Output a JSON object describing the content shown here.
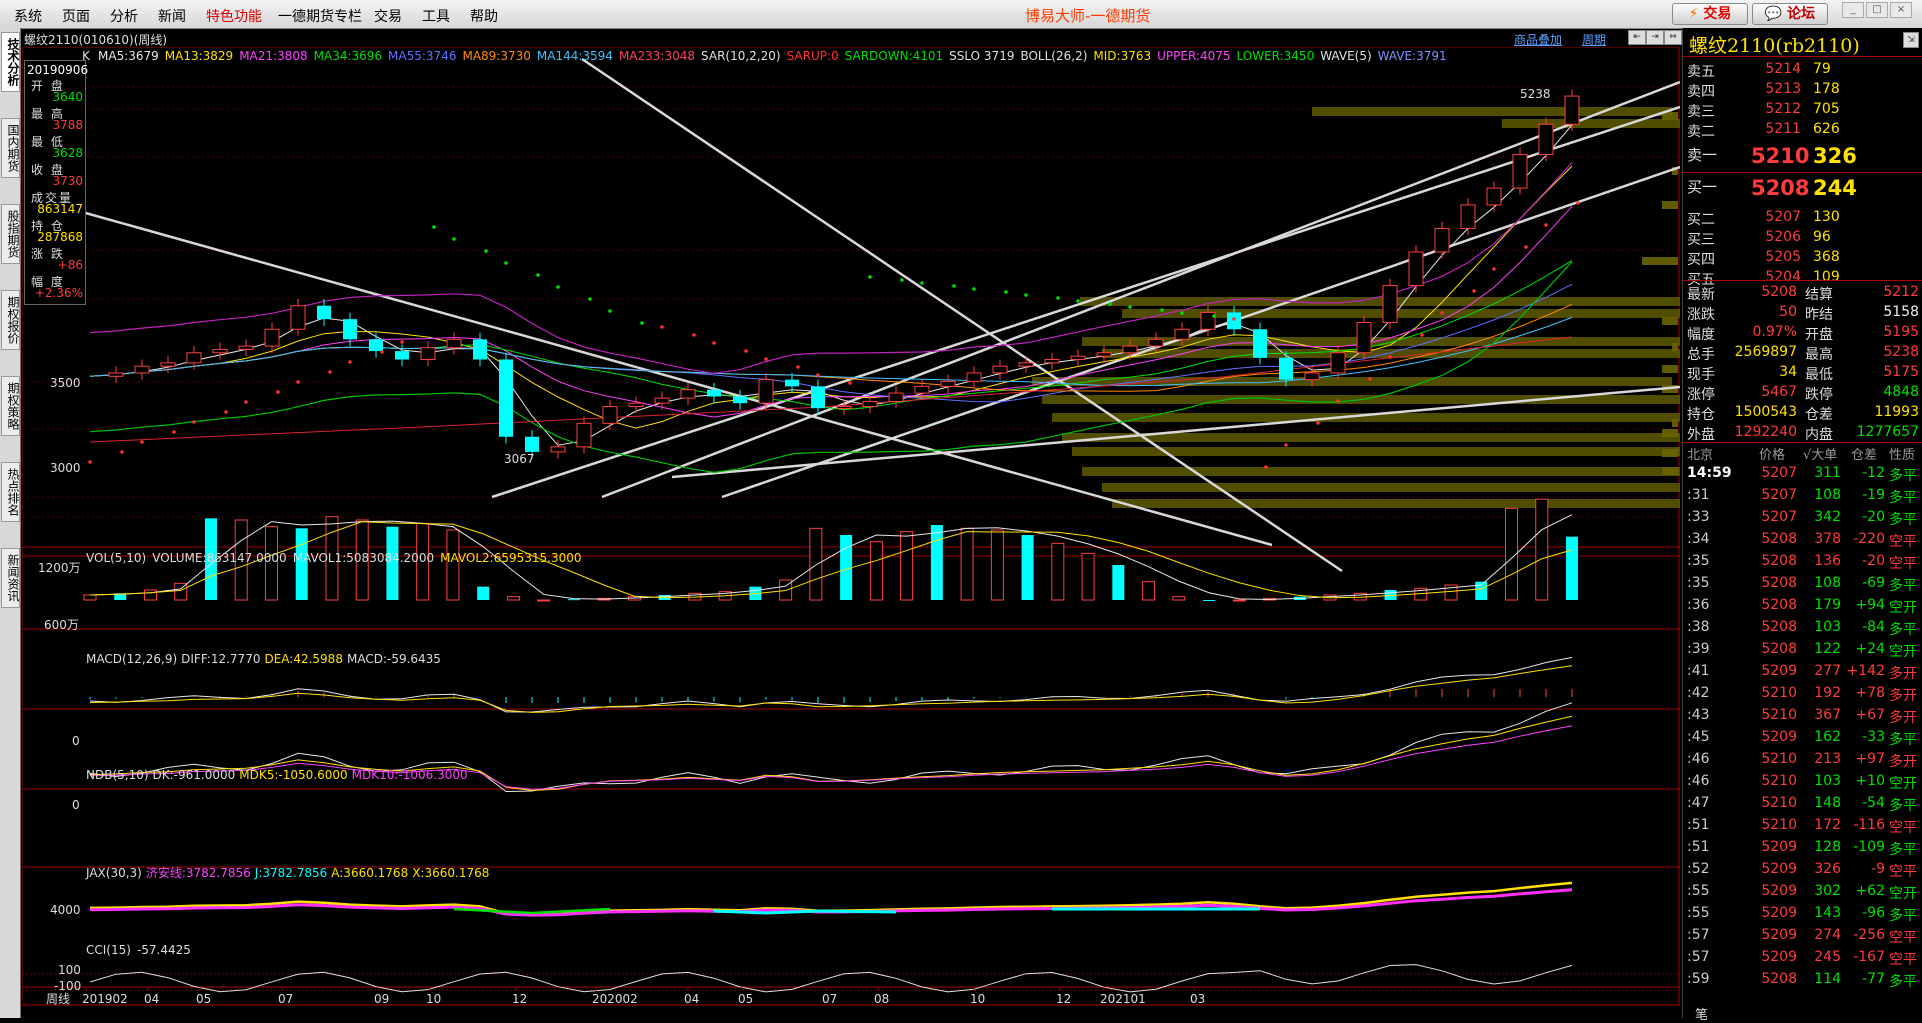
{
  "menu": {
    "items": [
      "系统",
      "页面",
      "分析",
      "新闻",
      "特色功能",
      "一德期货专栏",
      "交易",
      "工具",
      "帮助"
    ],
    "special_index": 4,
    "app_title": "博易大师-一德期货",
    "trade_button": "交易",
    "forum_button": "论坛"
  },
  "left_tabs": [
    "技术分析",
    "国内期货",
    "股指期货",
    "期权报价",
    "期权策略",
    "热点排名",
    "新闻资讯"
  ],
  "header": {
    "symbol": "螺纹2110(010610)(周线)",
    "k_label": "K",
    "link_overlay": "商品叠加",
    "link_period": "周期",
    "ma_items": [
      {
        "text": "MA5:3679",
        "color": "#e8e8e8"
      },
      {
        "text": "MA13:3829",
        "color": "#ffe000"
      },
      {
        "text": "MA21:3808",
        "color": "#ff40ff"
      },
      {
        "text": "MA34:3696",
        "color": "#00e000"
      },
      {
        "text": "MA55:3746",
        "color": "#6070ff"
      },
      {
        "text": "MA89:3730",
        "color": "#ff8c00"
      },
      {
        "text": "MA144:3594",
        "color": "#40c0ff"
      },
      {
        "text": "MA233:3048",
        "color": "#ff4060"
      },
      {
        "text": "SAR(10,2,20)",
        "color": "#e0e0e0"
      },
      {
        "text": "SARUP:0",
        "color": "#ff3030"
      },
      {
        "text": "SARDOWN:4101",
        "color": "#00e000"
      },
      {
        "text": "SSLO 3719",
        "color": "#e0e0e0"
      },
      {
        "text": "BOLL(26,2)",
        "color": "#e0e0e0"
      },
      {
        "text": "MID:3763",
        "color": "#ffe000"
      },
      {
        "text": "UPPER:4075",
        "color": "#ff40ff"
      },
      {
        "text": "LOWER:3450",
        "color": "#00e000"
      },
      {
        "text": "WAVE(5)",
        "color": "#e0e0e0"
      },
      {
        "text": "WAVE:3791",
        "color": "#8090ff"
      }
    ]
  },
  "infobox": {
    "date": "20190906",
    "rows": [
      {
        "label": "开  盘",
        "value": "3640",
        "color": "#00e000"
      },
      {
        "label": "最  高",
        "value": "3788",
        "color": "#ff3b3b"
      },
      {
        "label": "最  低",
        "value": "3628",
        "color": "#00e000"
      },
      {
        "label": "收  盘",
        "value": "3730",
        "color": "#ff3b3b"
      },
      {
        "label": "成交量",
        "value": "863147",
        "color": "#ffe000"
      },
      {
        "label": "持  仓",
        "value": "287868",
        "color": "#ffe000"
      },
      {
        "label": "涨  跌",
        "value": "+86",
        "color": "#ff3b3b"
      },
      {
        "label": "幅  度",
        "value": "+2.36%",
        "color": "#ff3b3b"
      }
    ]
  },
  "panels": {
    "price_axis": [
      "3500",
      "3000"
    ],
    "price_partial": "4000",
    "high_label": "5238",
    "low_label": "3067",
    "vol_header": [
      {
        "text": "VOL(5,10)",
        "color": "#ddd"
      },
      {
        "text": "VOLUME:863147.0000",
        "color": "#ddd"
      },
      {
        "text": "MAVOL1:5083084.2000",
        "color": "#ddd"
      },
      {
        "text": "MAVOL2:6595315.3000",
        "color": "#ffe000"
      }
    ],
    "vol_axis": [
      "1200万",
      "600万"
    ],
    "macd_header": [
      {
        "text": "MACD(12,26,9)",
        "color": "#ddd"
      },
      {
        "text": "DIFF:12.7770",
        "color": "#ddd"
      },
      {
        "text": "DEA:42.5988",
        "color": "#ffe000"
      },
      {
        "text": "MACD:-59.6435",
        "color": "#ddd"
      }
    ],
    "macd_axis": "0",
    "ndb_header": [
      {
        "text": "NDB(5,10)",
        "color": "#ddd"
      },
      {
        "text": "DK:-961.0000",
        "color": "#ddd"
      },
      {
        "text": "MDK5:-1050.6000",
        "color": "#ffe000"
      },
      {
        "text": "MDK10:-1006.3000",
        "color": "#ff40ff"
      }
    ],
    "ndb_axis": "0",
    "jax_header": [
      {
        "text": "JAX(30,3)",
        "color": "#ddd"
      },
      {
        "text": "济安线:3782.7856",
        "color": "#ff40ff"
      },
      {
        "text": "J:3782.7856",
        "color": "#00ffff"
      },
      {
        "text": "A:3660.1768",
        "color": "#ffe000"
      },
      {
        "text": "X:3660.1768",
        "color": "#ffe000"
      }
    ],
    "jax_axis": "4000",
    "cci_header": [
      {
        "text": "CCI(15)",
        "color": "#ddd"
      },
      {
        "text": "-57.4425",
        "color": "#ddd"
      }
    ],
    "cci_axis": [
      "100",
      "-100"
    ]
  },
  "time_axis": {
    "label": "周线",
    "ticks": [
      "201902",
      "04",
      "05",
      "07",
      "09",
      "10",
      "12",
      "202002",
      "04",
      "05",
      "07",
      "08",
      "10",
      "12",
      "202101",
      "03"
    ]
  },
  "right_panel": {
    "title": "螺纹2110(rb2110)",
    "asks": [
      {
        "label": "卖五",
        "price": "5214",
        "vol": "79"
      },
      {
        "label": "卖四",
        "price": "5213",
        "vol": "178"
      },
      {
        "label": "卖三",
        "price": "5212",
        "vol": "705"
      },
      {
        "label": "卖二",
        "price": "5211",
        "vol": "626"
      },
      {
        "label": "卖一",
        "price": "5210",
        "vol": "326"
      }
    ],
    "bids": [
      {
        "label": "买一",
        "price": "5208",
        "vol": "244"
      },
      {
        "label": "买二",
        "price": "5207",
        "vol": "130"
      },
      {
        "label": "买三",
        "price": "5206",
        "vol": "96"
      },
      {
        "label": "买四",
        "price": "5205",
        "vol": "368"
      },
      {
        "label": "买五",
        "price": "5204",
        "vol": "109"
      }
    ],
    "quote": [
      {
        "l1": "最新",
        "v1": "5208",
        "c1": "red",
        "l2": "结算",
        "v2": "5212",
        "c2": "red"
      },
      {
        "l1": "涨跌",
        "v1": "50",
        "c1": "red",
        "l2": "昨结",
        "v2": "5158",
        "c2": "white"
      },
      {
        "l1": "幅度",
        "v1": "0.97%",
        "c1": "red",
        "l2": "开盘",
        "v2": "5195",
        "c2": "red"
      },
      {
        "l1": "总手",
        "v1": "2569897",
        "c1": "yellow",
        "l2": "最高",
        "v2": "5238",
        "c2": "red"
      },
      {
        "l1": "现手",
        "v1": "34",
        "c1": "yellow",
        "l2": "最低",
        "v2": "5175",
        "c2": "red"
      },
      {
        "l1": "涨停",
        "v1": "5467",
        "c1": "red",
        "l2": "跌停",
        "v2": "4848",
        "c2": "green"
      },
      {
        "l1": "持仓",
        "v1": "1500543",
        "c1": "yellow",
        "l2": "仓差",
        "v2": "11993",
        "c2": "yellow"
      },
      {
        "l1": "外盘",
        "v1": "1292240",
        "c1": "red",
        "l2": "内盘",
        "v2": "1277657",
        "c2": "green"
      }
    ],
    "tick_header": [
      "北京",
      "价格",
      "√大单",
      "仓差",
      "性质"
    ],
    "ticks": [
      {
        "time": "14:59",
        "price": "5207",
        "vol": "311",
        "chg": "-12",
        "nature": "多平",
        "vc": "green",
        "cc": "green",
        "nc": "green"
      },
      {
        "time": ":31",
        "price": "5207",
        "vol": "108",
        "chg": "-19",
        "nature": "多平",
        "vc": "green",
        "cc": "green",
        "nc": "green"
      },
      {
        "time": ":33",
        "price": "5207",
        "vol": "342",
        "chg": "-20",
        "nature": "多平",
        "vc": "green",
        "cc": "green",
        "nc": "green"
      },
      {
        "time": ":34",
        "price": "5208",
        "vol": "378",
        "chg": "-220",
        "nature": "空平",
        "vc": "red",
        "cc": "red",
        "nc": "red"
      },
      {
        "time": ":35",
        "price": "5208",
        "vol": "136",
        "chg": "-20",
        "nature": "空平",
        "vc": "red",
        "cc": "red",
        "nc": "red"
      },
      {
        "time": ":35",
        "price": "5208",
        "vol": "108",
        "chg": "-69",
        "nature": "多平",
        "vc": "green",
        "cc": "green",
        "nc": "green"
      },
      {
        "time": ":36",
        "price": "5208",
        "vol": "179",
        "chg": "+94",
        "nature": "空开",
        "vc": "green",
        "cc": "green",
        "nc": "green"
      },
      {
        "time": ":38",
        "price": "5208",
        "vol": "103",
        "chg": "-84",
        "nature": "多平",
        "vc": "green",
        "cc": "green",
        "nc": "green"
      },
      {
        "time": ":39",
        "price": "5208",
        "vol": "122",
        "chg": "+24",
        "nature": "空开",
        "vc": "green",
        "cc": "green",
        "nc": "green"
      },
      {
        "time": ":41",
        "price": "5209",
        "vol": "277",
        "chg": "+142",
        "nature": "多开",
        "vc": "red",
        "cc": "red",
        "nc": "red"
      },
      {
        "time": ":42",
        "price": "5210",
        "vol": "192",
        "chg": "+78",
        "nature": "多开",
        "vc": "red",
        "cc": "red",
        "nc": "red"
      },
      {
        "time": ":43",
        "price": "5210",
        "vol": "367",
        "chg": "+67",
        "nature": "多开",
        "vc": "red",
        "cc": "red",
        "nc": "red"
      },
      {
        "time": ":45",
        "price": "5209",
        "vol": "162",
        "chg": "-33",
        "nature": "多平",
        "vc": "green",
        "cc": "green",
        "nc": "green"
      },
      {
        "time": ":46",
        "price": "5210",
        "vol": "213",
        "chg": "+97",
        "nature": "多开",
        "vc": "red",
        "cc": "red",
        "nc": "red"
      },
      {
        "time": ":46",
        "price": "5210",
        "vol": "103",
        "chg": "+10",
        "nature": "空开",
        "vc": "green",
        "cc": "green",
        "nc": "green"
      },
      {
        "time": ":47",
        "price": "5210",
        "vol": "148",
        "chg": "-54",
        "nature": "多平",
        "vc": "green",
        "cc": "green",
        "nc": "green"
      },
      {
        "time": ":51",
        "price": "5210",
        "vol": "172",
        "chg": "-116",
        "nature": "空平",
        "vc": "red",
        "cc": "red",
        "nc": "red"
      },
      {
        "time": ":51",
        "price": "5209",
        "vol": "128",
        "chg": "-109",
        "nature": "多平",
        "vc": "green",
        "cc": "green",
        "nc": "green"
      },
      {
        "time": ":52",
        "price": "5209",
        "vol": "326",
        "chg": "-9",
        "nature": "空平",
        "vc": "red",
        "cc": "red",
        "nc": "red"
      },
      {
        "time": ":55",
        "price": "5209",
        "vol": "302",
        "chg": "+62",
        "nature": "空开",
        "vc": "green",
        "cc": "green",
        "nc": "green"
      },
      {
        "time": ":55",
        "price": "5209",
        "vol": "143",
        "chg": "-96",
        "nature": "多平",
        "vc": "green",
        "cc": "green",
        "nc": "green"
      },
      {
        "time": ":57",
        "price": "5209",
        "vol": "274",
        "chg": "-256",
        "nature": "空平",
        "vc": "red",
        "cc": "red",
        "nc": "red"
      },
      {
        "time": ":57",
        "price": "5209",
        "vol": "245",
        "chg": "-167",
        "nature": "空平",
        "vc": "red",
        "cc": "red",
        "nc": "red"
      },
      {
        "time": ":59",
        "price": "5208",
        "vol": "114",
        "chg": "-77",
        "nature": "多平",
        "vc": "green",
        "cc": "green",
        "nc": "green"
      }
    ],
    "bottom_label": "笔"
  },
  "chart_data": {
    "type": "candlestick",
    "period": "weekly",
    "symbol": "螺纹2110",
    "price_series_approx": [
      3540,
      3560,
      3600,
      3620,
      3680,
      3700,
      3720,
      3820,
      3960,
      3880,
      3760,
      3690,
      3640,
      3710,
      3760,
      3640,
      3180,
      3090,
      3120,
      3260,
      3360,
      3380,
      3410,
      3460,
      3420,
      3380,
      3520,
      3480,
      3350,
      3360,
      3390,
      3440,
      3480,
      3510,
      3560,
      3600,
      3620,
      3640,
      3660,
      3680,
      3720,
      3760,
      3820,
      3920,
      3820,
      3650,
      3520,
      3560,
      3680,
      3860,
      4080,
      4280,
      4420,
      4560,
      4660,
      4860,
      5040,
      5208
    ],
    "volume_wan_approx": [
      60,
      80,
      120,
      200,
      980,
      960,
      880,
      860,
      1000,
      960,
      880,
      920,
      840,
      160,
      40,
      0,
      10,
      20,
      40,
      60,
      80,
      100,
      160,
      240,
      860,
      780,
      700,
      820,
      900,
      860,
      840,
      780,
      680,
      560,
      420,
      220,
      40,
      0,
      0,
      20,
      40,
      60,
      80,
      120,
      140,
      180,
      220,
      1100,
      1210,
      760
    ]
  }
}
